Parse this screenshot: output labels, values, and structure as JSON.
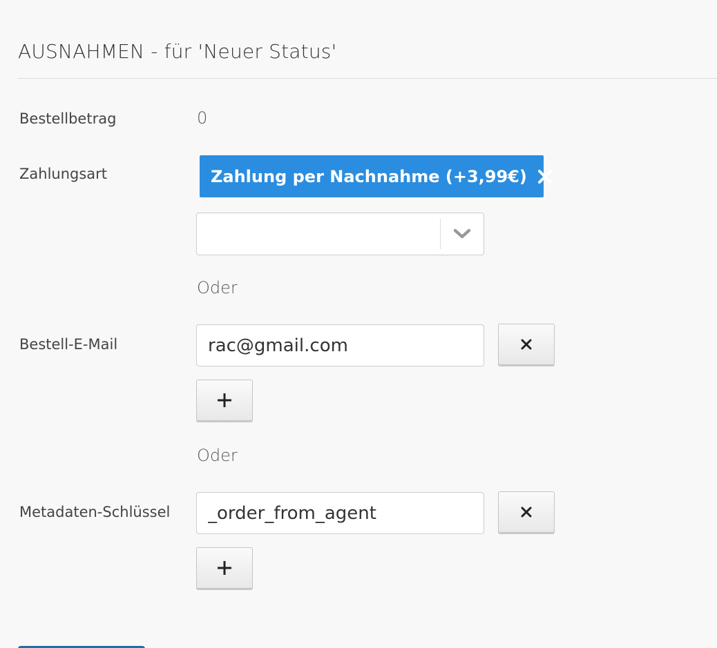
{
  "section": {
    "title": "AUSNAHMEN - für 'Neuer Status'"
  },
  "order_amount": {
    "label": "Bestellbetrag",
    "value": "0"
  },
  "payment_method": {
    "label": "Zahlungsart",
    "selected_tag": "Zahlung per Nachnahme (+3,99€)",
    "dropdown_value": ""
  },
  "separator_1": "Oder",
  "order_email": {
    "label": "Bestell-E-Mail",
    "value": "rac@gmail.com",
    "remove_label": "×",
    "add_label": "+"
  },
  "separator_2": "Oder",
  "meta_key": {
    "label": "Metadaten-Schlüssel",
    "value": "_order_from_agent",
    "remove_label": "×",
    "add_label": "+"
  },
  "colors": {
    "accent": "#2a8ddf",
    "background": "#f8f8f8"
  },
  "icons": {
    "tag_remove": "close-icon",
    "dropdown": "chevron-down-icon"
  }
}
